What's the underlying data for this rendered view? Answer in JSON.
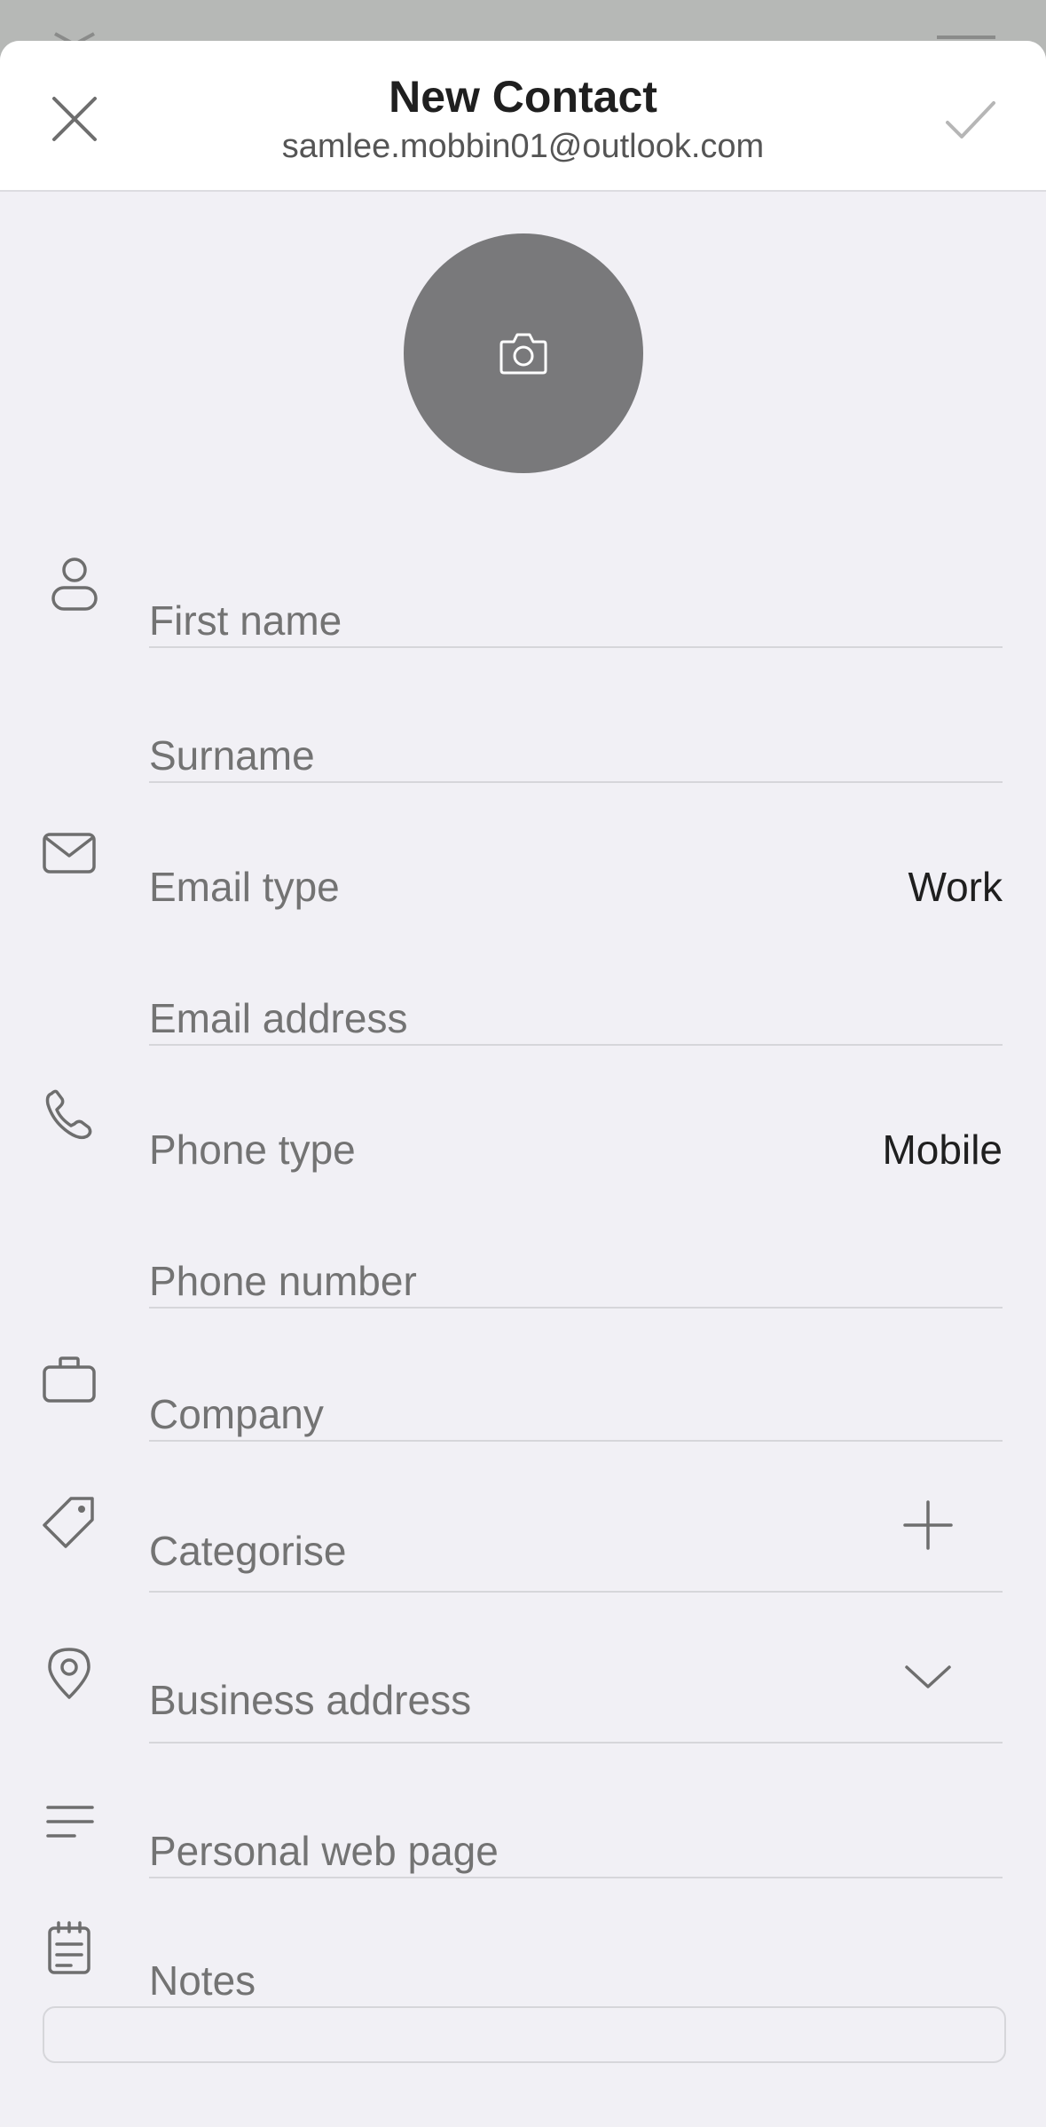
{
  "header": {
    "title": "New Contact",
    "account": "samlee.mobbin01@outlook.com"
  },
  "fields": {
    "first_name_placeholder": "First name",
    "surname_placeholder": "Surname",
    "email_type_label": "Email type",
    "email_type_value": "Work",
    "email_address_placeholder": "Email address",
    "phone_type_label": "Phone type",
    "phone_type_value": "Mobile",
    "phone_number_placeholder": "Phone number",
    "company_placeholder": "Company",
    "categorise_label": "Categorise",
    "business_address_label": "Business address",
    "personal_web_page_placeholder": "Personal web page",
    "notes_label": "Notes"
  },
  "icons": {
    "close": "close-icon",
    "save": "checkmark-icon",
    "photo": "camera-icon",
    "name": "person-icon",
    "email": "envelope-icon",
    "phone": "phone-icon",
    "company": "briefcase-icon",
    "category": "tag-icon",
    "address": "location-pin-icon",
    "web": "text-lines-icon",
    "notes": "notepad-icon",
    "add": "plus-icon",
    "expand": "chevron-down-icon"
  },
  "colors": {
    "sheet_background": "#f1f0f5",
    "header_background": "#ffffff",
    "avatar_fill": "#79797b",
    "placeholder_text": "#737373",
    "primary_text": "#1f1f1f"
  }
}
